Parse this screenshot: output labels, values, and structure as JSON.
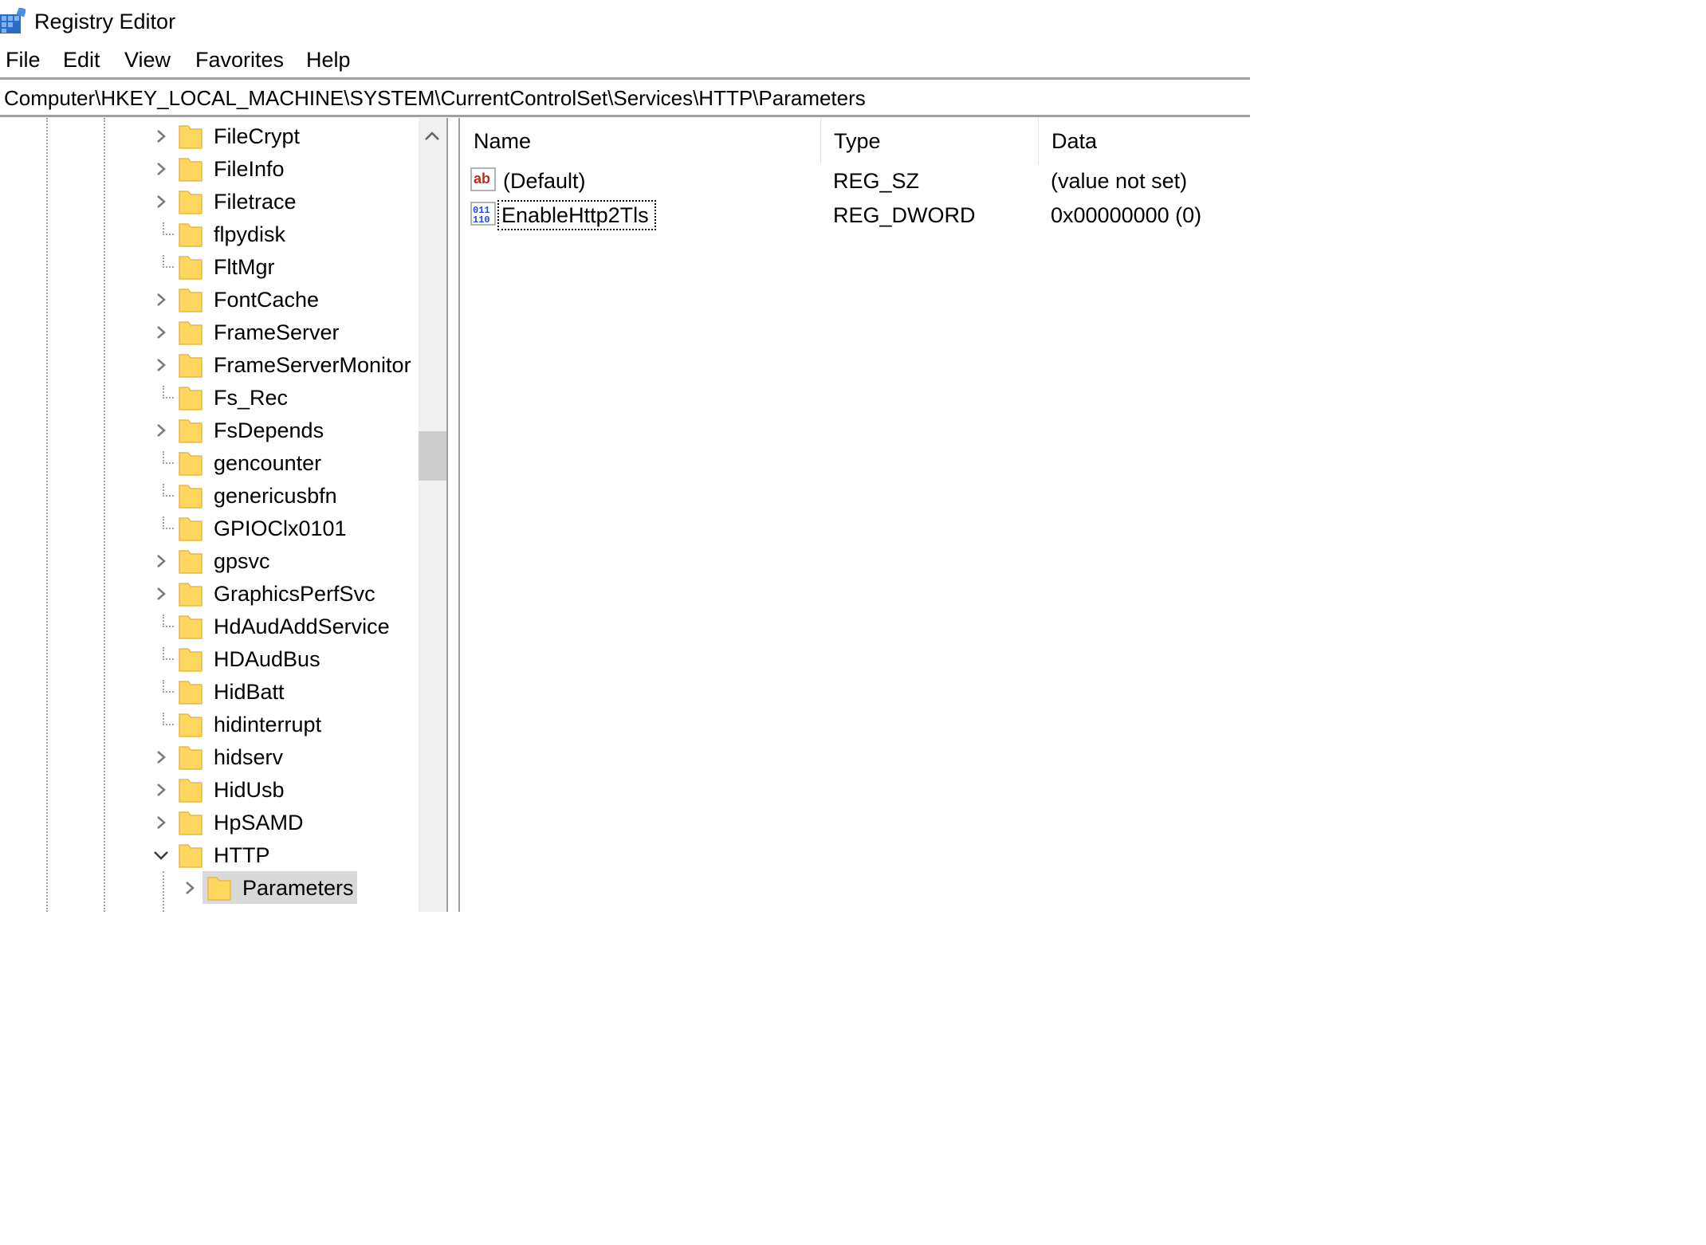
{
  "window": {
    "title": "Registry Editor",
    "app_icon": "registry-editor-icon"
  },
  "menu": {
    "file": "File",
    "edit": "Edit",
    "view": "View",
    "favorites": "Favorites",
    "help": "Help"
  },
  "address": {
    "path": "Computer\\HKEY_LOCAL_MACHINE\\SYSTEM\\CurrentControlSet\\Services\\HTTP\\Parameters"
  },
  "tree": {
    "items": [
      {
        "label": "FileCrypt",
        "expander": "collapsed"
      },
      {
        "label": "FileInfo",
        "expander": "collapsed"
      },
      {
        "label": "Filetrace",
        "expander": "collapsed"
      },
      {
        "label": "flpydisk",
        "expander": "none"
      },
      {
        "label": "FltMgr",
        "expander": "none"
      },
      {
        "label": "FontCache",
        "expander": "collapsed"
      },
      {
        "label": "FrameServer",
        "expander": "collapsed"
      },
      {
        "label": "FrameServerMonitor",
        "expander": "collapsed"
      },
      {
        "label": "Fs_Rec",
        "expander": "none"
      },
      {
        "label": "FsDepends",
        "expander": "collapsed"
      },
      {
        "label": "gencounter",
        "expander": "none"
      },
      {
        "label": "genericusbfn",
        "expander": "none"
      },
      {
        "label": "GPIOClx0101",
        "expander": "none"
      },
      {
        "label": "gpsvc",
        "expander": "collapsed"
      },
      {
        "label": "GraphicsPerfSvc",
        "expander": "collapsed"
      },
      {
        "label": "HdAudAddService",
        "expander": "none"
      },
      {
        "label": "HDAudBus",
        "expander": "none"
      },
      {
        "label": "HidBatt",
        "expander": "none"
      },
      {
        "label": "hidinterrupt",
        "expander": "none"
      },
      {
        "label": "hidserv",
        "expander": "collapsed"
      },
      {
        "label": "HidUsb",
        "expander": "collapsed"
      },
      {
        "label": "HpSAMD",
        "expander": "collapsed"
      },
      {
        "label": "HTTP",
        "expander": "expanded"
      },
      {
        "label": "Parameters",
        "expander": "collapsed",
        "selected": true
      }
    ]
  },
  "list": {
    "columns": {
      "name": "Name",
      "type": "Type",
      "data": "Data"
    },
    "rows": [
      {
        "name": "(Default)",
        "type": "REG_SZ",
        "data": "(value not set)",
        "icon": "string-value-icon"
      },
      {
        "name": "EnableHttp2Tls",
        "type": "REG_DWORD",
        "data": "0x00000000 (0)",
        "icon": "binary-value-icon",
        "focused": true
      }
    ]
  },
  "colors": {
    "folder_fill": "#ffd75e",
    "folder_edge": "#e6b84a",
    "selection": "#d9d9d9",
    "icon_red": "#c42b1c",
    "icon_blue": "#1e4bd2"
  }
}
